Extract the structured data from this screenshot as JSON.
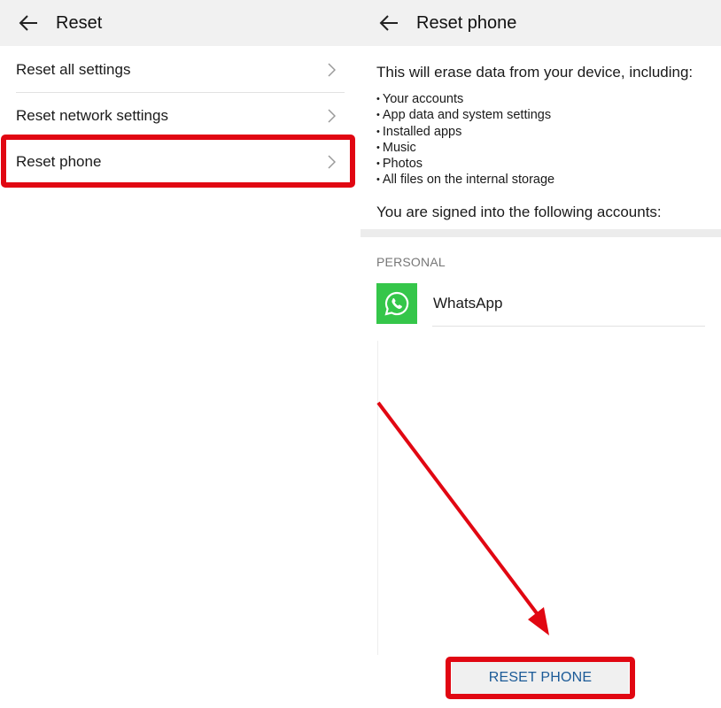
{
  "left_panel": {
    "title": "Reset",
    "items": [
      {
        "label": "Reset all settings"
      },
      {
        "label": "Reset network settings"
      },
      {
        "label": "Reset phone"
      }
    ],
    "highlighted_item": "Reset phone"
  },
  "right_panel": {
    "title": "Reset phone",
    "intro": "This will erase data from your device, including:",
    "erase_items": [
      "Your accounts",
      "App data and system settings",
      "Installed apps",
      "Music",
      "Photos",
      "All files on the internal storage"
    ],
    "signed_in_text": "You are signed into the following accounts:",
    "section_header": "PERSONAL",
    "accounts": [
      {
        "name": "WhatsApp",
        "icon": "whatsapp-icon"
      }
    ],
    "reset_button_label": "RESET PHONE"
  },
  "annotations": {
    "highlight_color": "#e10712",
    "arrow": "points-to-reset-button"
  },
  "colors": {
    "topbar_bg": "#f1f1f1",
    "button_text": "#1b5a97",
    "whatsapp_green": "#35c64a"
  }
}
